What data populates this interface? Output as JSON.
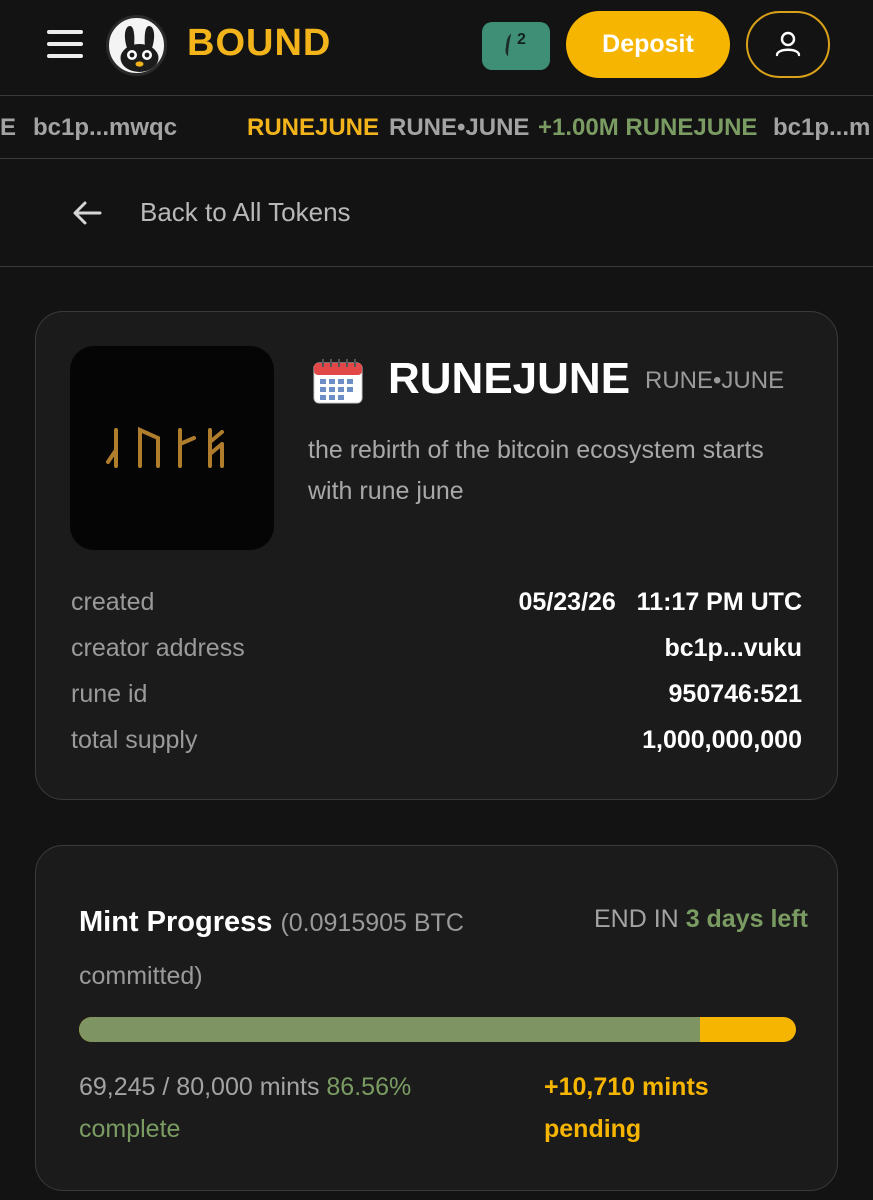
{
  "header": {
    "brand": "BOUND",
    "notification_count": "2",
    "deposit_label": "Deposit",
    "icons": [
      "menu-icon",
      "bunny-logo-icon",
      "notification-icon",
      "user-icon"
    ]
  },
  "ticker": {
    "items": [
      {
        "text": "E",
        "color": "gray"
      },
      {
        "text": "bc1p...mwqc",
        "color": "gray"
      },
      {
        "text": "RUNEJUNE",
        "color": "yellow"
      },
      {
        "text": "RUNE•JUNE",
        "color": "gray"
      },
      {
        "text": "+1.00M RUNEJUNE",
        "color": "green"
      },
      {
        "text": "bc1p...m",
        "color": "gray"
      }
    ]
  },
  "back": {
    "label": "Back to All Tokens"
  },
  "token": {
    "name": "RUNEJUNE",
    "ticker": "RUNE•JUNE",
    "description": "the rebirth of the bitcoin ecosystem starts with rune june",
    "image_text": "ᛃᚢᚾᛖ",
    "info": [
      {
        "label": "created",
        "value": "05/23/26   11:17 PM UTC"
      },
      {
        "label": "creator address",
        "value": "bc1p...vuku"
      },
      {
        "label": "rune id",
        "value": "950746:521"
      },
      {
        "label": "total supply",
        "value": "1,000,000,000"
      }
    ]
  },
  "mint": {
    "title": "Mint Progress",
    "committed": "(0.0915905 BTC committed)",
    "end_prefix": "END IN",
    "end_value": "3 days left",
    "minted": "69,245 / 80,000 mints",
    "percent": "86.56% complete",
    "pending": "+10,710 mints pending",
    "progress_fraction": 0.8656
  },
  "colors": {
    "accent": "#f5b500",
    "success": "#7a9c62",
    "background": "#131313",
    "card": "#1b1b1b"
  }
}
